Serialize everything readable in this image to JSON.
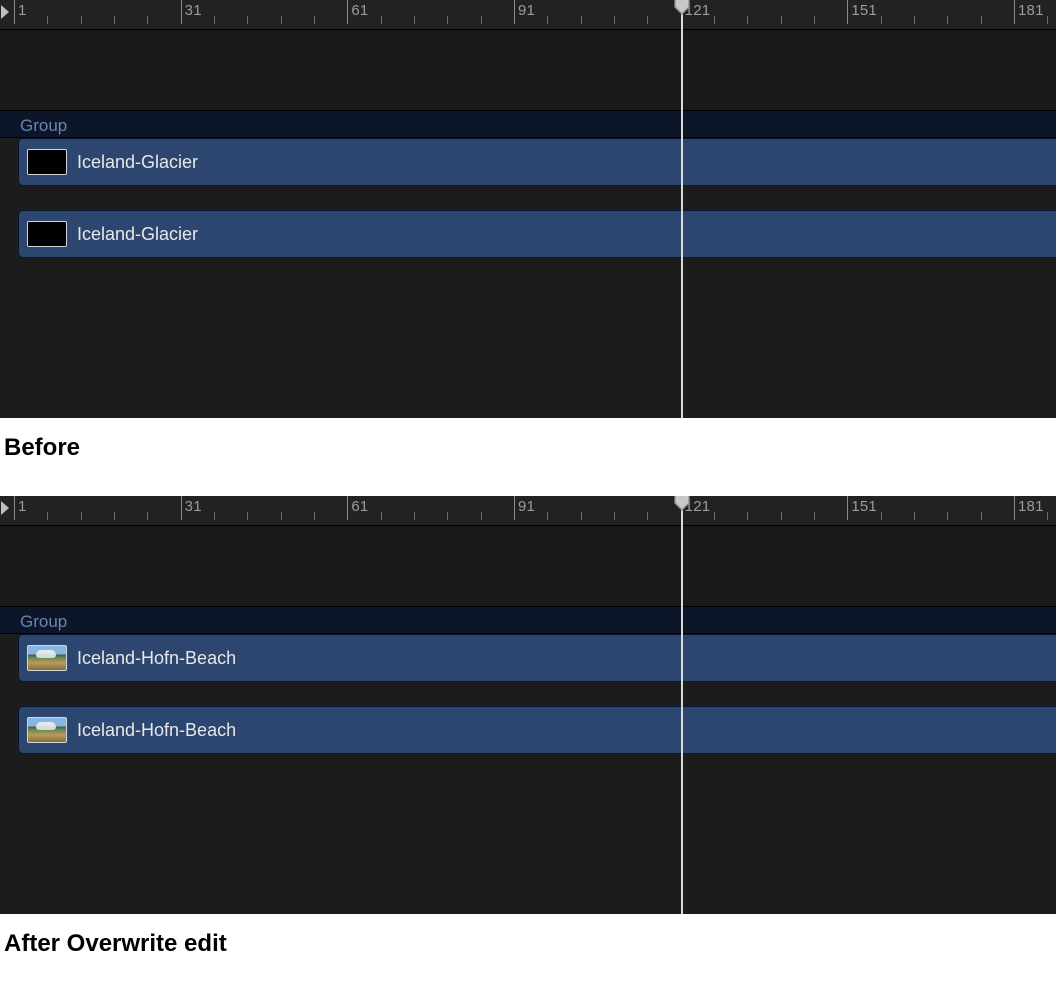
{
  "ruler": {
    "major_ticks": [
      1,
      31,
      61,
      91,
      121,
      151,
      181
    ],
    "minor_per_major": 5,
    "playhead_frame": 121
  },
  "before": {
    "group_label": "Group",
    "clip1_label": "Iceland-Glacier",
    "clip2_label": "Iceland-Glacier",
    "caption": "Before"
  },
  "after": {
    "group_label": "Group",
    "clip1_label": "Iceland-Hofn-Beach",
    "clip2_label": "Iceland-Hofn-Beach",
    "caption": "After Overwrite edit"
  }
}
